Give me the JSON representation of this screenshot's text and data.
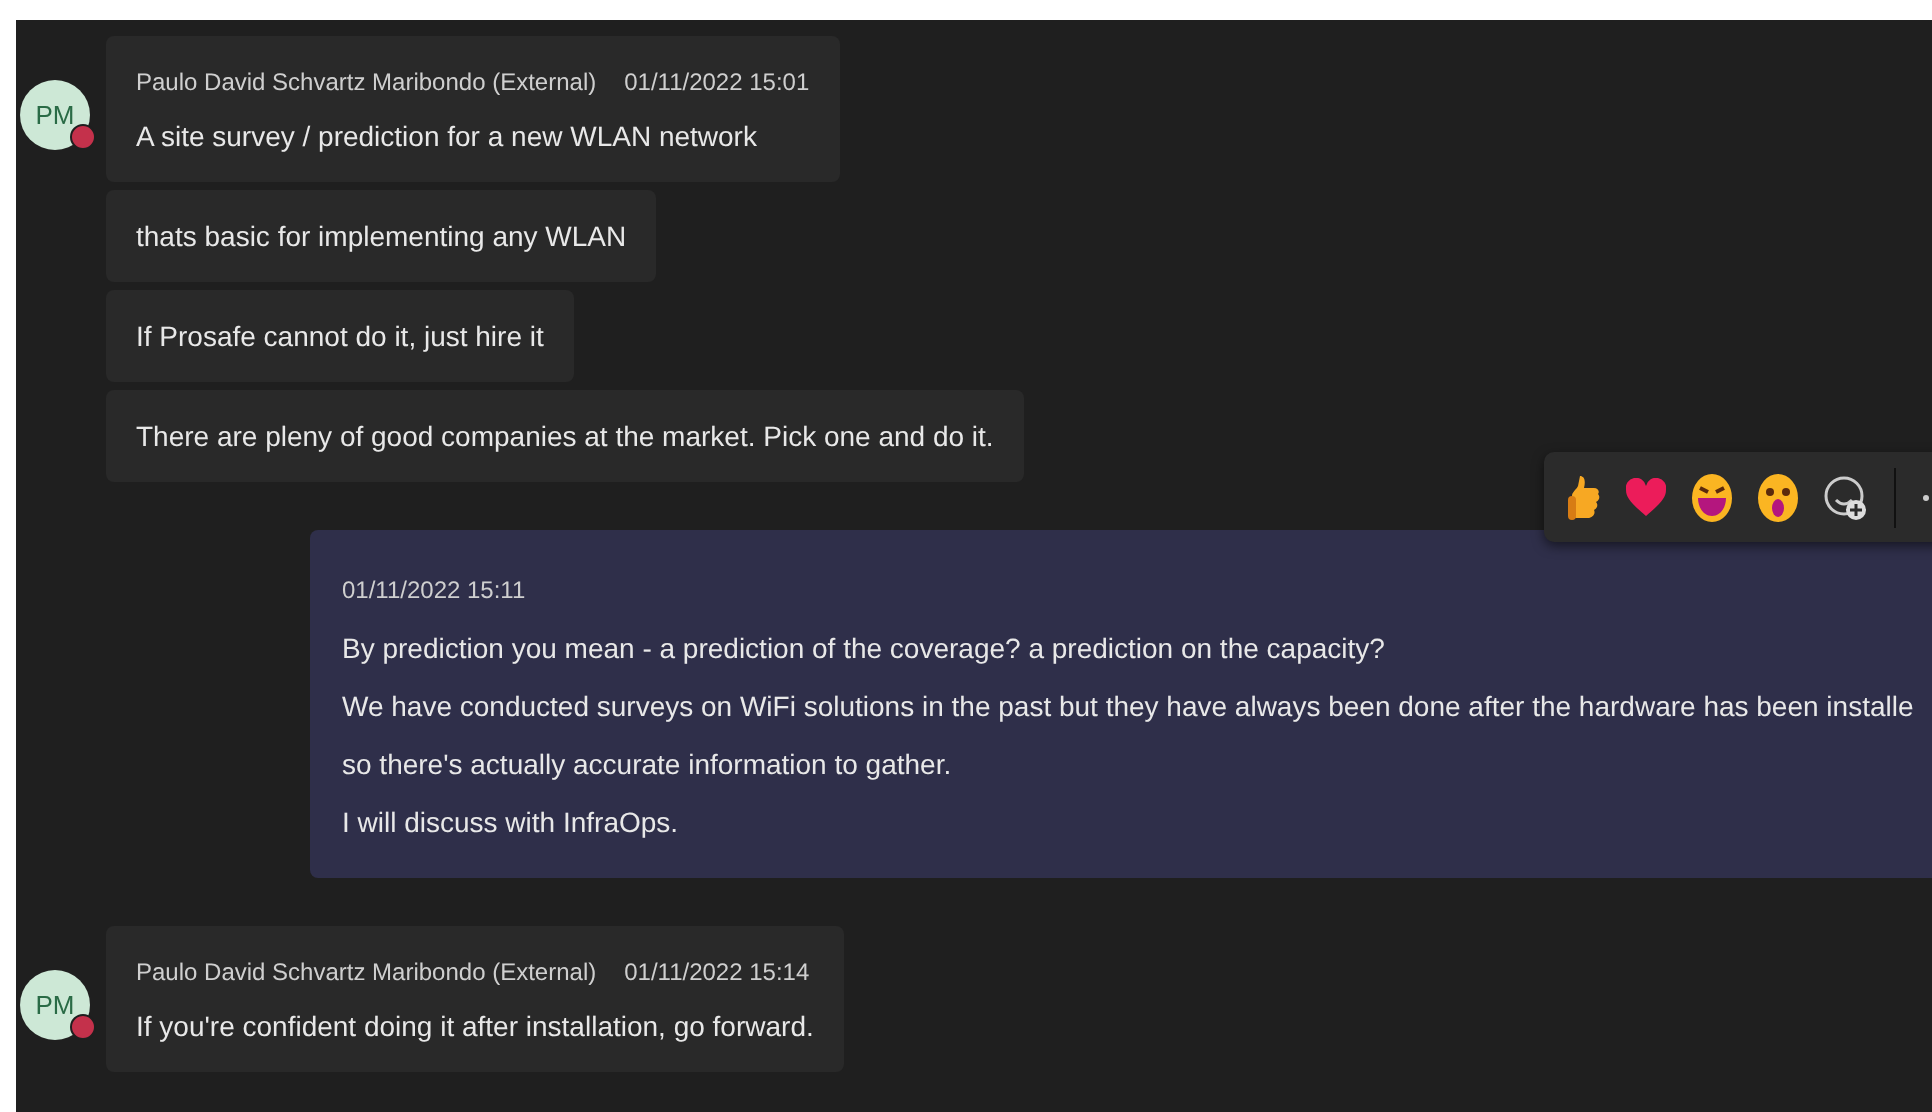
{
  "groups": [
    {
      "kind": "incoming",
      "avatar": "PM",
      "color": "#c4314b",
      "sender": "Paulo David Schvartz Maribondo (External)",
      "time": "01/11/2022 15:01",
      "bubbles": [
        [
          "A site survey / prediction for a new WLAN network"
        ],
        [
          "thats basic for implementing any WLAN"
        ],
        [
          "If Prosafe cannot do it, just hire it"
        ],
        [
          "There are pleny of good companies at the market. Pick one and do it."
        ]
      ]
    },
    {
      "kind": "outgoing",
      "hovered": true,
      "time": "01/11/2022 15:11",
      "bubbles": [
        [
          "By prediction you mean - a prediction of the coverage? a prediction on the capacity?",
          "We have conducted surveys on WiFi solutions in the past but they have always been done after the hardware has been installe",
          "so there's actually accurate information to gather.",
          "I will discuss with InfraOps."
        ]
      ]
    },
    {
      "kind": "incoming",
      "avatar": "PM",
      "color": "#c4314b",
      "sender": "Paulo David Schvartz Maribondo (External)",
      "time": "01/11/2022 15:14",
      "bubbles": [
        [
          "If you're confident doing it after installation, go forward."
        ]
      ]
    }
  ]
}
